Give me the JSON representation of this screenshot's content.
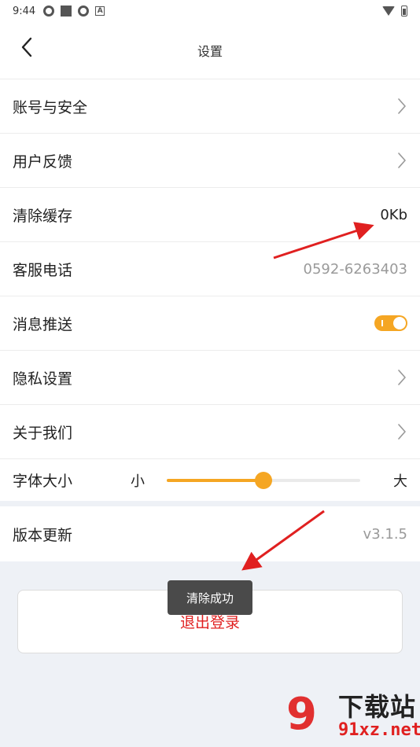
{
  "status": {
    "time": "9:44",
    "icons": [
      "aperture-icon",
      "square-icon",
      "aperture-icon",
      "a-box-icon"
    ],
    "right_icons": [
      "wifi-icon",
      "battery-icon"
    ]
  },
  "header": {
    "title": "设置",
    "back_icon": "chevron-left-icon"
  },
  "settings": [
    {
      "label": "账号与安全",
      "right": "chevron"
    },
    {
      "label": "用户反馈",
      "right": "chevron"
    },
    {
      "label": "清除缓存",
      "right": "value",
      "value": "0Kb"
    },
    {
      "label": "客服电话",
      "right": "value",
      "value": "0592-6263403"
    },
    {
      "label": "消息推送",
      "right": "toggle",
      "on": true
    },
    {
      "label": "隐私设置",
      "right": "chevron"
    },
    {
      "label": "关于我们",
      "right": "chevron"
    }
  ],
  "font_size": {
    "label": "字体大小",
    "small_label": "小",
    "large_label": "大",
    "level": 0.5
  },
  "version": {
    "label": "版本更新",
    "value": "v3.1.5"
  },
  "logout": {
    "label": "退出登录"
  },
  "toast": {
    "message": "清除成功"
  },
  "watermark": {
    "brand_mark": "9",
    "brand_text": "下载站",
    "url": "91xz.net"
  },
  "colors": {
    "accent": "#f5a623",
    "danger": "#e02020",
    "annotation": "#e02020"
  }
}
